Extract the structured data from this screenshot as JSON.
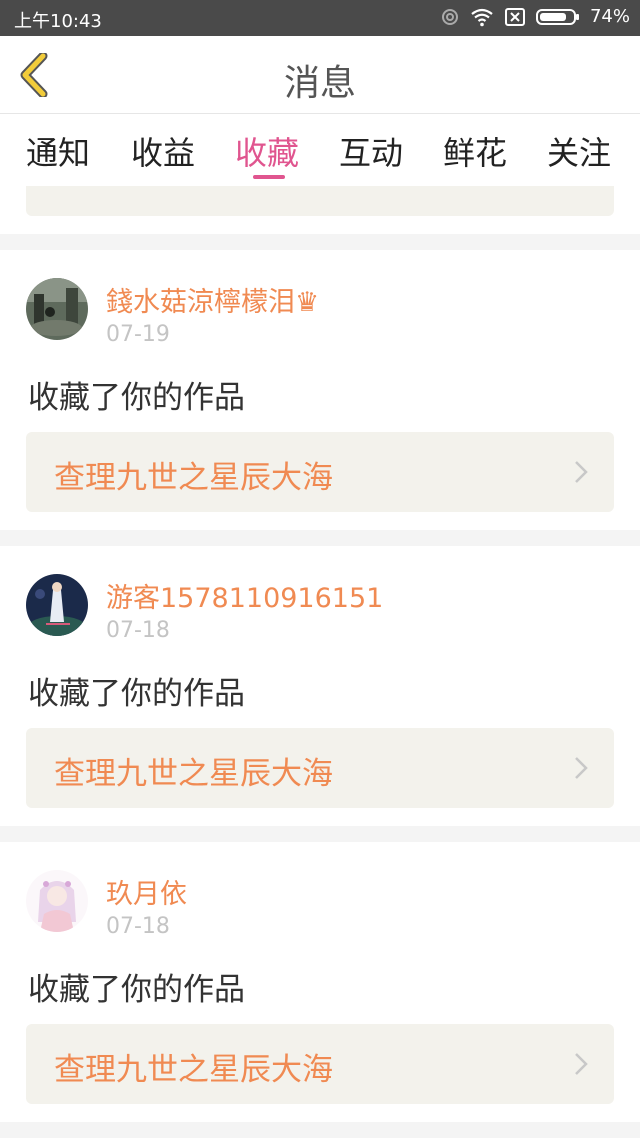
{
  "status_bar": {
    "time": "上午10:43",
    "battery": "74%"
  },
  "header": {
    "title": "消息"
  },
  "tabs": [
    {
      "label": "通知",
      "active": false
    },
    {
      "label": "收益",
      "active": false
    },
    {
      "label": "收藏",
      "active": true
    },
    {
      "label": "互动",
      "active": false
    },
    {
      "label": "鲜花",
      "active": false
    },
    {
      "label": "关注",
      "active": false
    }
  ],
  "items": [
    {
      "username": "錢水菇涼檸檬泪♛",
      "date": "07-19",
      "action": "收藏了你的作品",
      "work_title": "查理九世之星辰大海"
    },
    {
      "username": "游客1578110916151",
      "date": "07-18",
      "action": "收藏了你的作品",
      "work_title": "查理九世之星辰大海"
    },
    {
      "username": "玖月依",
      "date": "07-18",
      "action": "收藏了你的作品",
      "work_title": "查理九世之星辰大海"
    }
  ],
  "colors": {
    "accent": "#e0558f",
    "link_text": "#f08a52",
    "back_arrow": "#f2cc3a"
  }
}
